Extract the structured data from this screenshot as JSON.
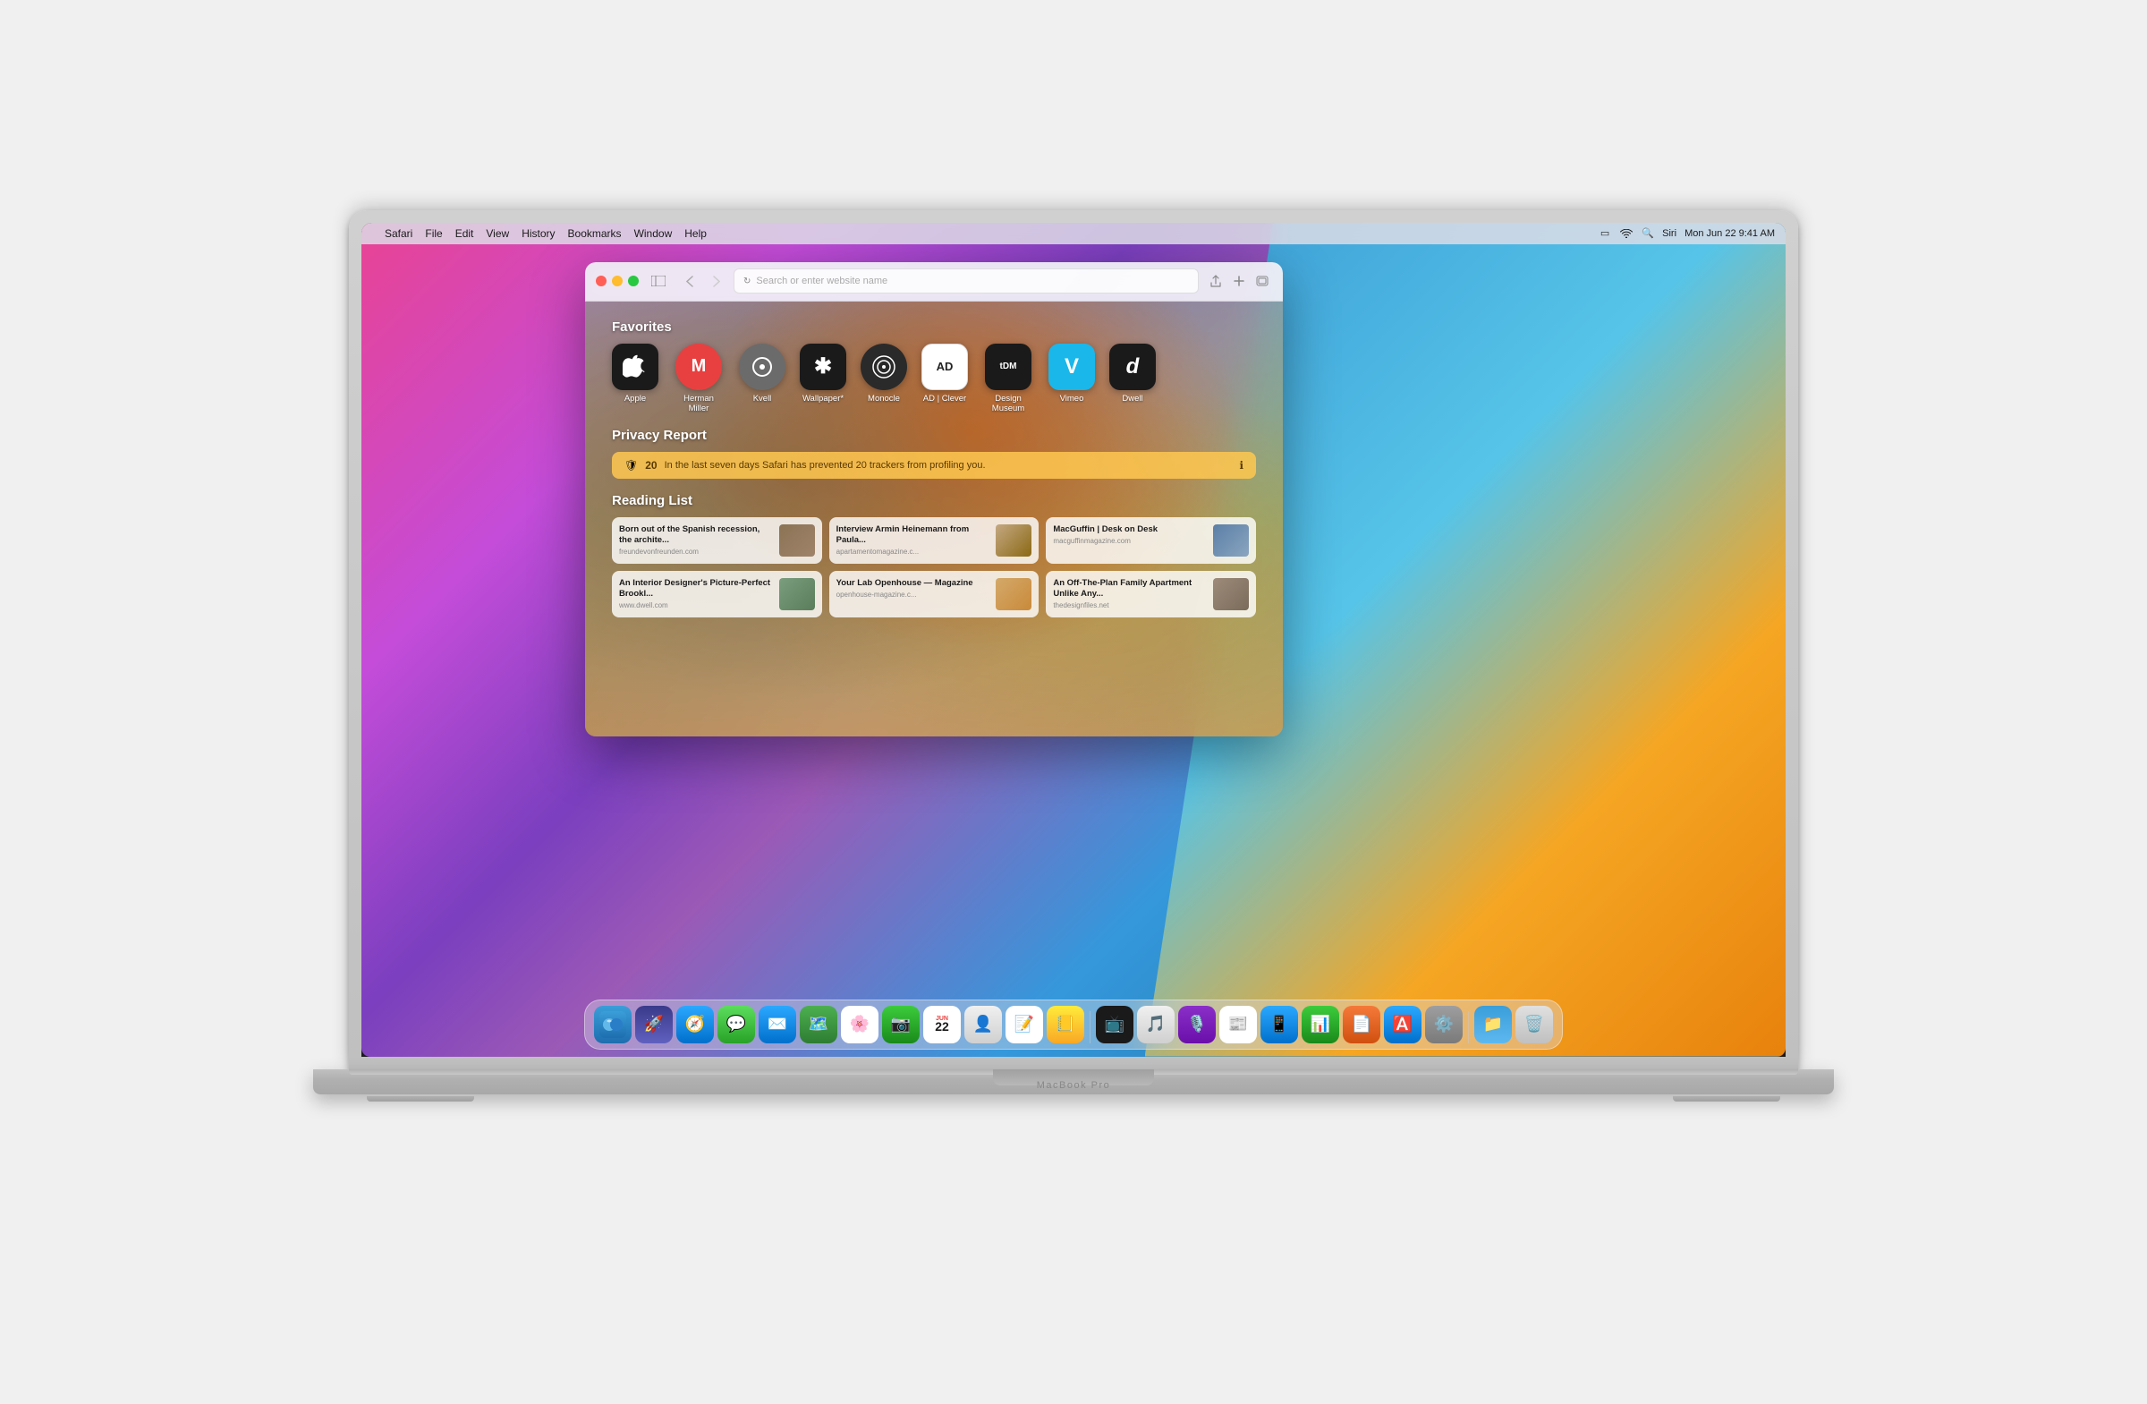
{
  "macbook": {
    "model_label": "MacBook Pro"
  },
  "menubar": {
    "apple_symbol": "",
    "app_name": "Safari",
    "menu_items": [
      "File",
      "Edit",
      "View",
      "History",
      "Bookmarks",
      "Window",
      "Help"
    ],
    "time": "Mon Jun 22  9:41 AM"
  },
  "safari": {
    "addressbar_placeholder": "Search or enter website name",
    "toolbar": {
      "back": "‹",
      "forward": "›",
      "share": "↑",
      "new_tab": "+",
      "sidebar": "⊞"
    }
  },
  "new_tab": {
    "favorites_title": "Favorites",
    "favorites": [
      {
        "name": "Apple",
        "bg": "fi-apple",
        "symbol": ""
      },
      {
        "name": "Herman Miller",
        "bg": "fi-herman",
        "symbol": "🔴"
      },
      {
        "name": "Kvell",
        "bg": "fi-kvell",
        "symbol": "●"
      },
      {
        "name": "Wallpaper*",
        "bg": "fi-wallpaper",
        "symbol": "✱"
      },
      {
        "name": "Monocle",
        "bg": "fi-monocle",
        "symbol": "⊛"
      },
      {
        "name": "AD | Clever",
        "bg": "fi-ad",
        "symbol": "AD"
      },
      {
        "name": "Design Museum",
        "bg": "fi-designmuseum",
        "symbol": "tDM"
      },
      {
        "name": "Vimeo",
        "bg": "fi-vimeo",
        "symbol": "V"
      },
      {
        "name": "Dwell",
        "bg": "fi-dwell",
        "symbol": "d"
      }
    ],
    "privacy_title": "Privacy Report",
    "privacy_count": "20",
    "privacy_text": "In the last seven days Safari has prevented 20 trackers from profiling you.",
    "reading_title": "Reading List",
    "reading_items": [
      {
        "title": "Born out of the Spanish recession, the archite...",
        "domain": "freundevonfreunden.com",
        "thumb_class": "thumb-1"
      },
      {
        "title": "Interview Armin Heinemann from Paula...",
        "domain": "apartamentomagazine.c...",
        "thumb_class": "thumb-2"
      },
      {
        "title": "MacGuffin | Desk on Desk",
        "domain": "macguffinmagazine.com",
        "thumb_class": "thumb-3"
      },
      {
        "title": "An Interior Designer's Picture-Perfect Brookl...",
        "domain": "www.dwell.com",
        "thumb_class": "thumb-4"
      },
      {
        "title": "Your Lab Openhouse — Magazine",
        "domain": "openhouse-magazine.c...",
        "thumb_class": "thumb-5"
      },
      {
        "title": "An Off-The-Plan Family Apartment Unlike Any...",
        "domain": "thedesignfiles.net",
        "thumb_class": "thumb-6"
      }
    ]
  },
  "dock": {
    "items": [
      {
        "name": "Finder",
        "class": "dock-finder",
        "symbol": "🔵",
        "emoji": "🖥"
      },
      {
        "name": "Launchpad",
        "class": "dock-launchpad",
        "symbol": "🚀",
        "emoji": "🚀"
      },
      {
        "name": "Safari",
        "class": "dock-safari",
        "symbol": "🧭",
        "emoji": "🧭"
      },
      {
        "name": "Messages",
        "class": "dock-messages",
        "symbol": "💬",
        "emoji": "💬"
      },
      {
        "name": "Mail",
        "class": "dock-mail",
        "symbol": "✉️",
        "emoji": "✉️"
      },
      {
        "name": "Maps",
        "class": "dock-maps",
        "symbol": "🗺",
        "emoji": "🗺"
      },
      {
        "name": "Photos",
        "class": "dock-photos",
        "symbol": "🌸",
        "emoji": "🌸"
      },
      {
        "name": "FaceTime",
        "class": "dock-facetime",
        "symbol": "📷",
        "emoji": "📷"
      },
      {
        "name": "Calendar",
        "class": "dock-calendar",
        "symbol": "📅",
        "emoji": "📅"
      },
      {
        "name": "Contacts",
        "class": "dock-contacts",
        "symbol": "👤",
        "emoji": "👤"
      },
      {
        "name": "Reminders",
        "class": "dock-reminders",
        "symbol": "📝",
        "emoji": "📝"
      },
      {
        "name": "Notes",
        "class": "dock-notes",
        "symbol": "📒",
        "emoji": "📒"
      },
      {
        "name": "Apple TV",
        "class": "dock-tv",
        "symbol": "📺",
        "emoji": "📺"
      },
      {
        "name": "Music",
        "class": "dock-music",
        "symbol": "🎵",
        "emoji": "🎵"
      },
      {
        "name": "Podcasts",
        "class": "dock-podcasts",
        "symbol": "🎙",
        "emoji": "🎙"
      },
      {
        "name": "News",
        "class": "dock-news",
        "symbol": "📰",
        "emoji": "📰"
      },
      {
        "name": "Sidecar",
        "class": "dock-sidecar",
        "symbol": "📱",
        "emoji": "📱"
      },
      {
        "name": "Numbers",
        "class": "dock-numbers",
        "symbol": "📊",
        "emoji": "📊"
      },
      {
        "name": "Pages",
        "class": "dock-pages",
        "symbol": "📄",
        "emoji": "📄"
      },
      {
        "name": "App Store",
        "class": "dock-appstore",
        "symbol": "🅰",
        "emoji": "🅰"
      },
      {
        "name": "System Preferences",
        "class": "dock-prefs",
        "symbol": "⚙️",
        "emoji": "⚙️"
      },
      {
        "name": "Finder Window",
        "class": "dock-findmy",
        "symbol": "📁",
        "emoji": "📁"
      },
      {
        "name": "Trash",
        "class": "dock-trash",
        "symbol": "🗑",
        "emoji": "🗑"
      }
    ]
  }
}
